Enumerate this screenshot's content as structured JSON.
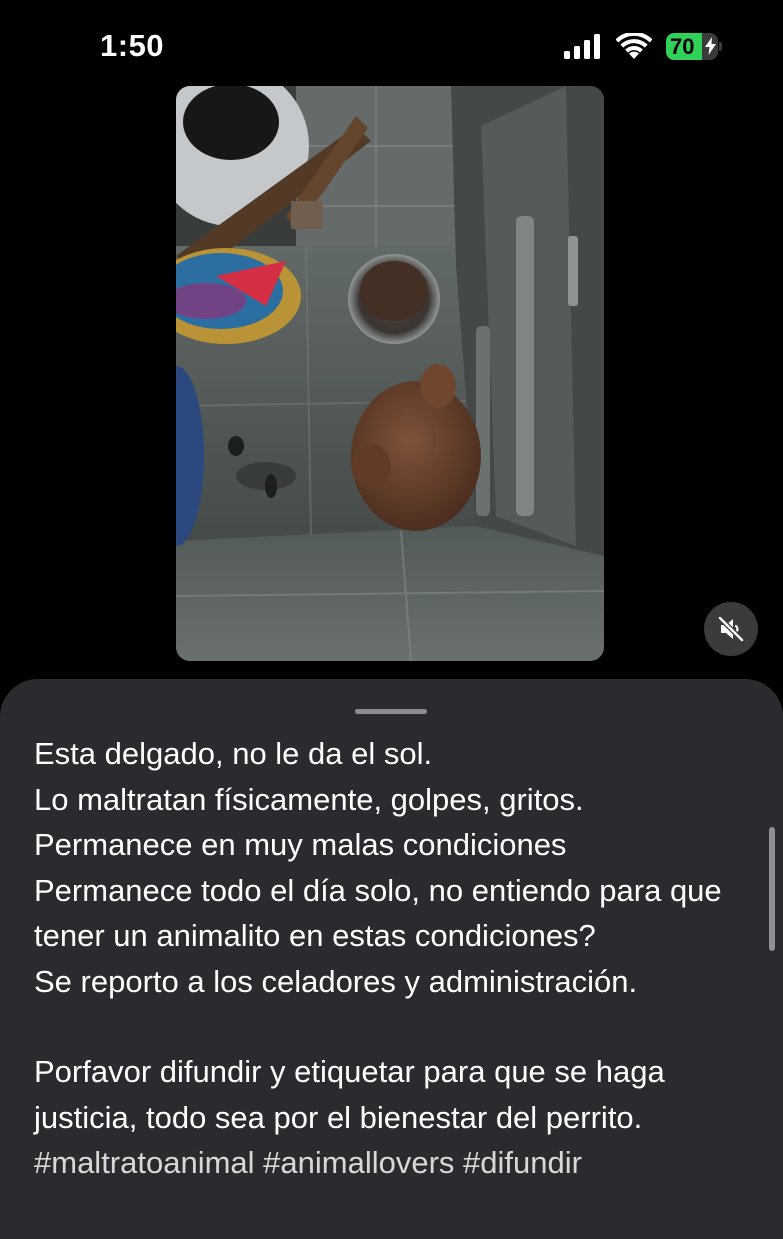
{
  "status_bar": {
    "time": "1:50",
    "battery_percent": "70",
    "battery_level": 0.7,
    "charging": true
  },
  "media": {
    "muted": true
  },
  "caption": {
    "lines": [
      "Esta delgado, no le da el sol.",
      "Lo maltratan físicamente, golpes, gritos.",
      "Permanece en muy malas condiciones",
      "Permanece todo el día solo, no entiendo para que tener un animalito en estas condiciones?",
      "Se reporto a los celadores y administración."
    ],
    "paragraph2": "Porfavor difundir y etiquetar para que se haga justicia, todo sea por el bienestar del perrito.",
    "hashtags": "#maltratoanimal #animallovers #difundir"
  },
  "colors": {
    "background": "#000000",
    "sheet": "#2a2b2f",
    "battery_green": "#30d158",
    "text": "#ffffff"
  }
}
